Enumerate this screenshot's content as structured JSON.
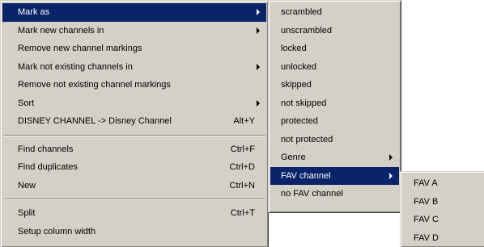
{
  "main_menu": {
    "group1": [
      {
        "label": "Mark as",
        "submenu": true,
        "active": true
      },
      {
        "label": "Mark new channels in",
        "submenu": true
      },
      {
        "label": "Remove new channel markings"
      },
      {
        "label": "Mark not existing channels in",
        "submenu": true
      },
      {
        "label": "Remove not existing channel markings"
      },
      {
        "label": "Sort",
        "submenu": true
      },
      {
        "label": "DISNEY CHANNEL -> Disney Channel",
        "shortcut": "Alt+Y"
      }
    ],
    "group2": [
      {
        "label": "Find channels",
        "shortcut": "Ctrl+F"
      },
      {
        "label": "Find duplicates",
        "shortcut": "Ctrl+D"
      },
      {
        "label": "New",
        "shortcut": "Ctrl+N"
      }
    ],
    "group3": [
      {
        "label": "Split",
        "shortcut": "Ctrl+T"
      },
      {
        "label": "Setup column width"
      }
    ]
  },
  "mark_as_menu": [
    {
      "label": "scrambled"
    },
    {
      "label": "unscrambled"
    },
    {
      "label": "locked"
    },
    {
      "label": "unlocked"
    },
    {
      "label": "skipped"
    },
    {
      "label": "not skipped"
    },
    {
      "label": "protected"
    },
    {
      "label": "not protected"
    },
    {
      "label": "Genre",
      "submenu": true
    },
    {
      "label": "FAV channel",
      "submenu": true,
      "active": true
    },
    {
      "label": "no FAV channel"
    }
  ],
  "fav_menu": [
    {
      "label": "FAV A"
    },
    {
      "label": "FAV B"
    },
    {
      "label": "FAV C"
    },
    {
      "label": "FAV D"
    }
  ],
  "colors": {
    "menu_bg": "#d4d0c8",
    "highlight": "#0a246a",
    "highlight_text": "#ffffff"
  }
}
